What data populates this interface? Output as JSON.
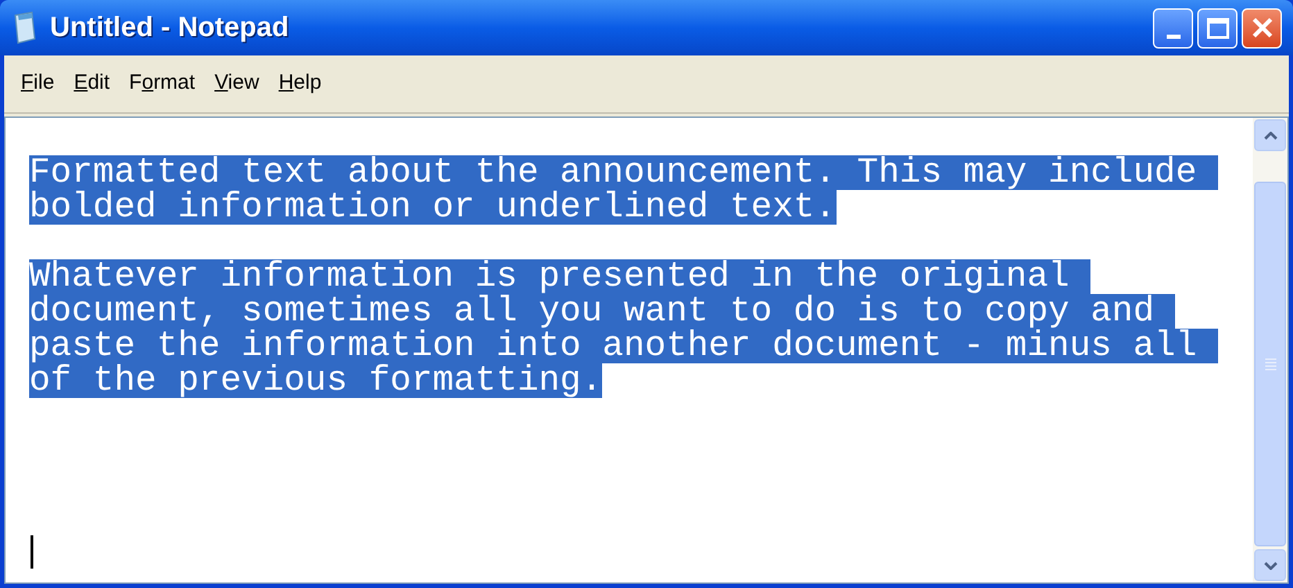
{
  "window": {
    "title": "Untitled - Notepad"
  },
  "menu": [
    {
      "key": "F",
      "after": "ile"
    },
    {
      "key": "E",
      "after": "dit"
    },
    {
      "before": "F",
      "key": "o",
      "after": "rmat"
    },
    {
      "key": "V",
      "after": "iew"
    },
    {
      "key": "H",
      "after": "elp"
    }
  ],
  "document": {
    "paragraphs": [
      {
        "lines": [
          {
            "text": "Formatted text about the announcement. This may include ",
            "selected": true
          },
          {
            "text": "bolded information or underlined text.",
            "selected": true
          }
        ]
      },
      {
        "lines": [
          {
            "text": "Whatever information is presented in the original ",
            "selected": true
          },
          {
            "text": "document, sometimes all you want to do is to copy and ",
            "selected": true
          },
          {
            "text": "paste the information into another document - minus all ",
            "selected": true
          },
          {
            "text": "of the previous formatting.",
            "selected": true
          }
        ]
      }
    ]
  }
}
